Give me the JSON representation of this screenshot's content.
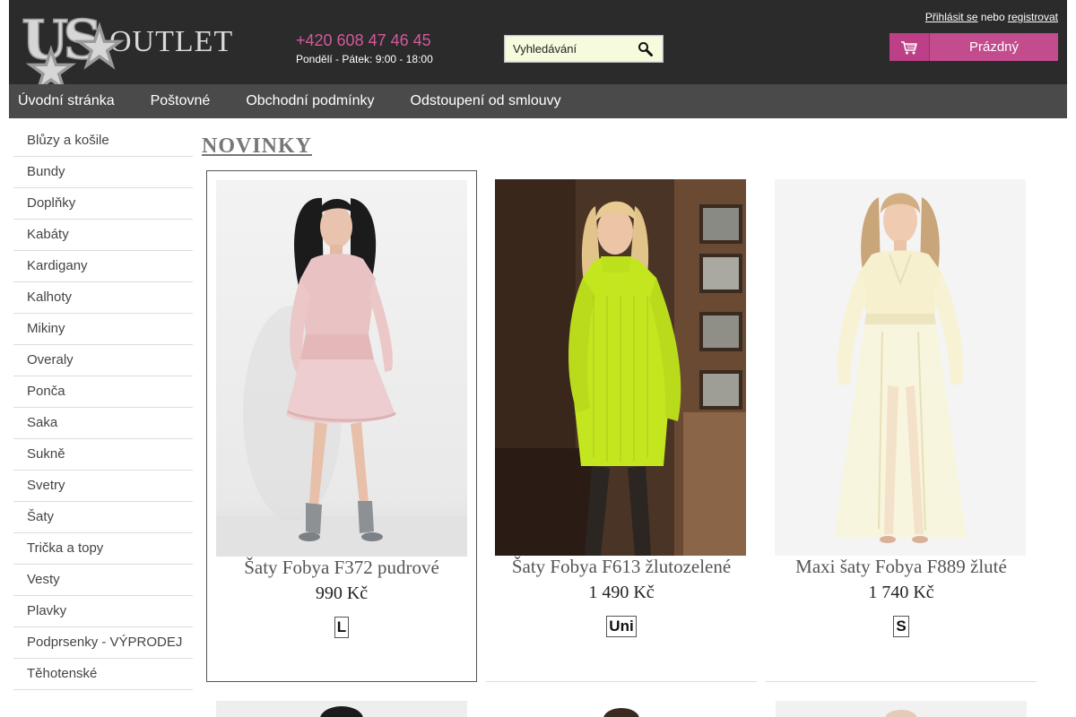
{
  "brand": {
    "logo_mark": "US",
    "logo_text": "OUTLET"
  },
  "contact": {
    "phone": "+420 608 47 46 45",
    "hours": "Pondělí - Pátek: 9:00 - 18:00"
  },
  "search": {
    "placeholder": "Vyhledávání",
    "icon": "search-icon"
  },
  "account": {
    "login_label": "Přihlásit se",
    "or_label": "nebo",
    "register_label": "registrovat"
  },
  "cart": {
    "icon": "cart-icon",
    "label": "Prázdný"
  },
  "nav": {
    "items": [
      {
        "label": "Úvodní stránka"
      },
      {
        "label": "Poštovné"
      },
      {
        "label": "Obchodní podmínky"
      },
      {
        "label": "Odstoupení od smlouvy"
      }
    ]
  },
  "sidebar": {
    "items": [
      {
        "label": "Blůzy a košile"
      },
      {
        "label": "Bundy"
      },
      {
        "label": "Doplňky"
      },
      {
        "label": "Kabáty"
      },
      {
        "label": "Kardigany"
      },
      {
        "label": "Kalhoty"
      },
      {
        "label": "Mikiny"
      },
      {
        "label": "Overaly"
      },
      {
        "label": "Ponča"
      },
      {
        "label": "Saka"
      },
      {
        "label": "Sukně"
      },
      {
        "label": "Svetry"
      },
      {
        "label": "Šaty"
      },
      {
        "label": "Trička a topy"
      },
      {
        "label": "Vesty"
      },
      {
        "label": "Plavky"
      },
      {
        "label": "Podprsenky - VÝPRODEJ"
      },
      {
        "label": "Těhotenské"
      }
    ]
  },
  "main": {
    "section_title": "NOVINKY",
    "products": [
      {
        "name": "Šaty Fobya F372 pudrové",
        "price": "990 Kč",
        "sizes": [
          "L"
        ]
      },
      {
        "name": "Šaty Fobya F613 žlutozelené",
        "price": "1 490 Kč",
        "sizes": [
          "Uni"
        ]
      },
      {
        "name": "Maxi šaty Fobya F889 žluté",
        "price": "1 740 Kč",
        "sizes": [
          "S"
        ]
      }
    ]
  },
  "colors": {
    "header_bg": "#2b2b2b",
    "nav_bg": "#4a4a4a",
    "accent": "#c24c8e",
    "phone": "#d05a9a",
    "search_bg": "#f5fbdc"
  }
}
